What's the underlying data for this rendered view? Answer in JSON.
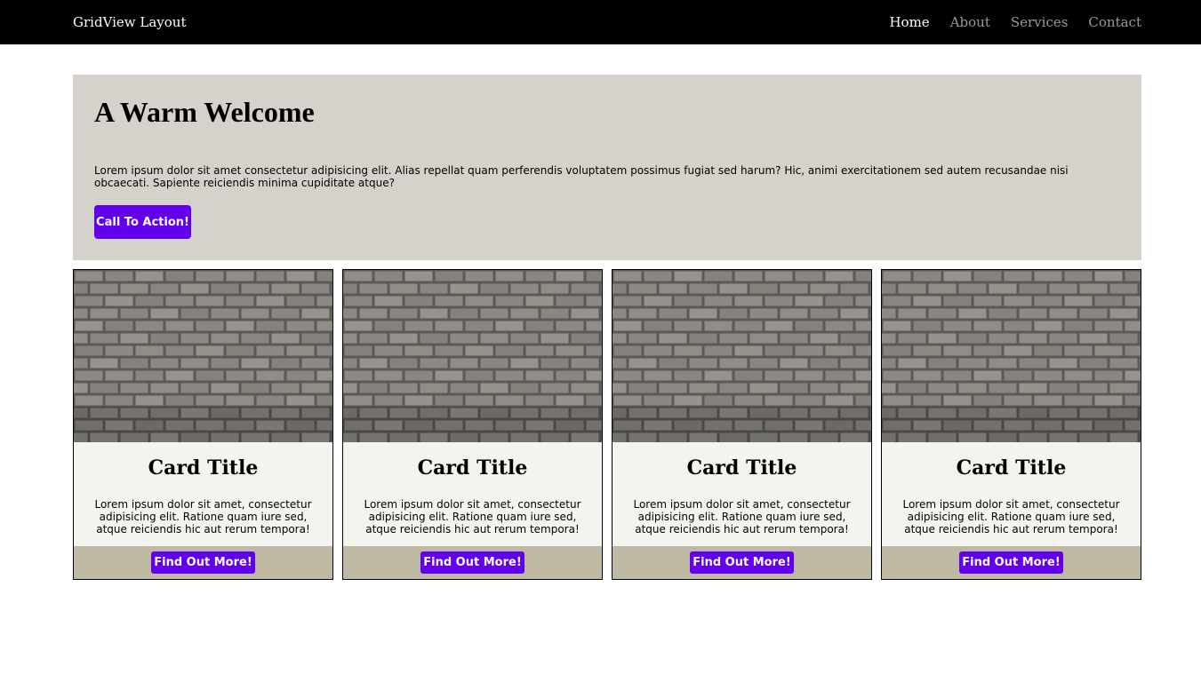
{
  "navbar": {
    "brand": "GridView Layout",
    "links": [
      {
        "label": "Home",
        "active": true
      },
      {
        "label": "About",
        "active": false
      },
      {
        "label": "Services",
        "active": false
      },
      {
        "label": "Contact",
        "active": false
      }
    ]
  },
  "hero": {
    "title": "A Warm Welcome",
    "text": "Lorem ipsum dolor sit amet consectetur adipisicing elit. Alias repellat quam perferendis voluptatem possimus fugiat sed harum? Hic, animi exercitationem sed autem recusandae nisi obcaecati. Sapiente reiciendis minima cupiditate atque?",
    "cta_label": "Call To Action!"
  },
  "cards": [
    {
      "title": "Card Title",
      "text": "Lorem ipsum dolor sit amet, consectetur adipisicing elit. Ratione quam iure sed, atque reiciendis hic aut rerum tempora!",
      "button": "Find Out More!"
    },
    {
      "title": "Card Title",
      "text": "Lorem ipsum dolor sit amet, consectetur adipisicing elit. Ratione quam iure sed, atque reiciendis hic aut rerum tempora!",
      "button": "Find Out More!"
    },
    {
      "title": "Card Title",
      "text": "Lorem ipsum dolor sit amet, consectetur adipisicing elit. Ratione quam iure sed, atque reiciendis hic aut rerum tempora!",
      "button": "Find Out More!"
    },
    {
      "title": "Card Title",
      "text": "Lorem ipsum dolor sit amet, consectetur adipisicing elit. Ratione quam iure sed, atque reiciendis hic aut rerum tempora!",
      "button": "Find Out More!"
    }
  ],
  "colors": {
    "navbar_bg": "#000000",
    "hero_bg": "#d4d2ca",
    "accent": "#6200ee",
    "card_bg": "#f5f3ee",
    "card_footer_bg": "#bfb8a3"
  },
  "icons": {
    "card_image": "brick-wall-image"
  }
}
